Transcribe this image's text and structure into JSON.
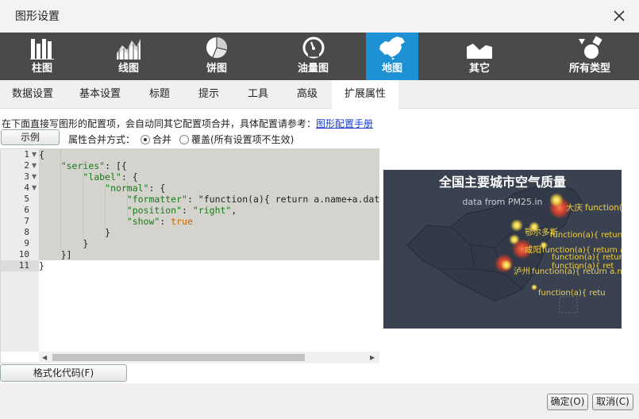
{
  "window": {
    "title": "图形设置"
  },
  "chart_types": [
    {
      "label": "柱图",
      "icon": "bar-chart-icon"
    },
    {
      "label": "线图",
      "icon": "line-chart-icon"
    },
    {
      "label": "饼图",
      "icon": "pie-chart-icon"
    },
    {
      "label": "油量图",
      "icon": "gauge-icon"
    },
    {
      "label": "地图",
      "icon": "china-map-icon",
      "active": true
    },
    {
      "label": "其它",
      "icon": "area-shape-icon"
    },
    {
      "label": "所有类型",
      "icon": "shapes-icon"
    }
  ],
  "tabs": [
    "数据设置",
    "基本设置",
    "标题",
    "提示",
    "工具",
    "高级",
    "扩展属性"
  ],
  "active_tab": "扩展属性",
  "hint": {
    "text": "在下面直接写图形的配置项，会自动同其它配置项合并，具体配置请参考：",
    "link": "图形配置手册"
  },
  "example_button": "示例",
  "merge": {
    "label": "属性合并方式：",
    "options": [
      {
        "label": "合并",
        "selected": true
      },
      {
        "label": "覆盖(所有设置项不生效)",
        "selected": false
      }
    ]
  },
  "code": {
    "line_numbers": [
      "1",
      "2",
      "3",
      "4",
      "5",
      "6",
      "7",
      "8",
      "9",
      "10",
      "11"
    ],
    "lines": [
      "{",
      "    \"series\": [{",
      "        \"label\": {",
      "            \"normal\": {",
      "                \"formatter\": \"function(a){ return a.name+a.data.v",
      "                \"position\": \"right\",",
      "                \"show\": true",
      "            }",
      "        }",
      "    }]",
      "}"
    ]
  },
  "format_button": "格式化代码(F)",
  "preview": {
    "title": "全国主要城市空气质量",
    "subtitle": "data from PM25.in",
    "labels": [
      "大庆",
      "function(a){",
      "鄂尔多斯",
      "function(a){ return a.n",
      "咸阳",
      "function(a){ return a.n",
      "function(a){ return a.n",
      "function(a){ ret",
      "泸州",
      "function(a){ return a.na",
      "function(a){ retu"
    ]
  },
  "footer": {
    "ok": "确定(O)",
    "cancel": "取消(C)"
  },
  "colors": {
    "active_type": "#1e90d4",
    "toolbar": "#4a4a4a",
    "preview_bg": "#3a4150",
    "point": "#f0d34a",
    "hot": "#e8402a"
  }
}
